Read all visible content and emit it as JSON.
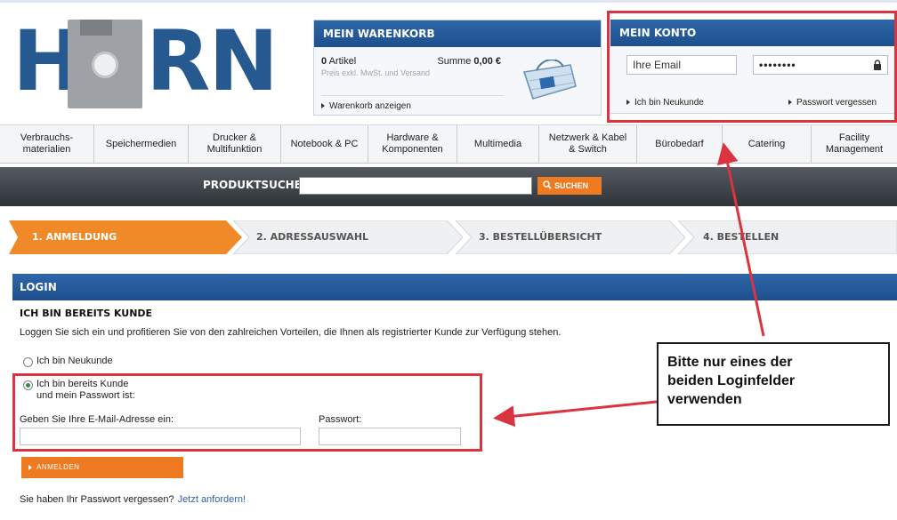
{
  "header": {
    "logo_text": "HORN"
  },
  "cart": {
    "title": "MEIN WARENKORB",
    "items_count": "0",
    "items_label": "Artikel",
    "sum_label": "Summe",
    "sum_value": "0,00 €",
    "price_note": "Preis exkl. MwSt. und Versand",
    "show_link": "Warenkorb anzeigen"
  },
  "account": {
    "title": "MEIN KONTO",
    "email_value": "Ihre Email",
    "password_value": "••••••••",
    "new_customer_link": "Ich bin Neukunde",
    "forgot_link": "Passwort vergessen"
  },
  "nav": {
    "items": [
      {
        "label": "Verbrauchs-\nmaterialien"
      },
      {
        "label": "Speichermedien"
      },
      {
        "label": "Drucker &\nMultifunktion"
      },
      {
        "label": "Notebook & PC"
      },
      {
        "label": "Hardware &\nKomponenten"
      },
      {
        "label": "Multimedia"
      },
      {
        "label": "Netzwerk & Kabel\n& Switch"
      },
      {
        "label": "Bürobedarf"
      },
      {
        "label": "Catering"
      },
      {
        "label": "Facility\nManagement"
      }
    ]
  },
  "search": {
    "label": "PRODUKTSUCHE",
    "button": "SUCHEN"
  },
  "steps": {
    "items": [
      {
        "label": "1. ANMELDUNG"
      },
      {
        "label": "2. ADRESSAUSWAHL"
      },
      {
        "label": "3. BESTELLÜBERSICHT"
      },
      {
        "label": "4. BESTELLEN"
      }
    ]
  },
  "login": {
    "title": "LOGIN",
    "subheading": "ICH BIN BEREITS KUNDE",
    "intro": "Loggen Sie sich ein und profitieren Sie von den zahlreichen Vorteilen, die Ihnen als registrierter Kunde zur Verfügung stehen.",
    "option_new": "Ich bin Neukunde",
    "option_existing_line1": "Ich bin bereits Kunde",
    "option_existing_line2": "und mein Passwort ist:",
    "email_label": "Geben Sie Ihre E-Mail-Adresse ein:",
    "password_label": "Passwort:",
    "submit_button": "ANMELDEN",
    "forgot_text": "Sie haben Ihr Passwort vergessen?",
    "forgot_link": "Jetzt anfordern!"
  },
  "annotation": {
    "callout_line1": "Bitte nur eines der",
    "callout_line2": "beiden Loginfelder",
    "callout_line3": "verwenden",
    "frame_color": "#d9343f"
  },
  "colors": {
    "brand_blue": "#26598f",
    "accent_orange": "#ee7a22"
  }
}
